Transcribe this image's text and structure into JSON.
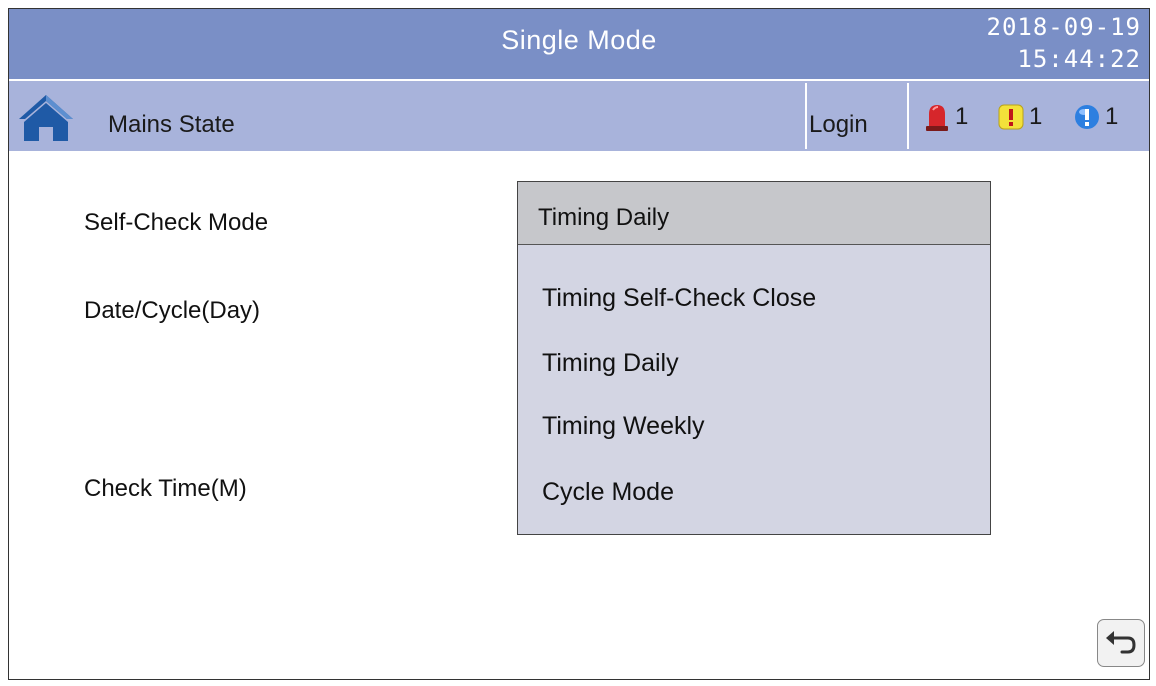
{
  "header": {
    "title": "Single Mode",
    "date": "2018-09-19",
    "time": "15:44:22"
  },
  "status_bar": {
    "home_icon": "home-icon",
    "state_label": "Mains State",
    "login_label": "Login",
    "alarms": [
      {
        "icon": "red-alarm-light-icon",
        "count": "1"
      },
      {
        "icon": "yellow-warning-icon",
        "count": "1"
      },
      {
        "icon": "blue-info-icon",
        "count": "1"
      }
    ]
  },
  "form": {
    "self_check_mode_label": "Self-Check Mode",
    "date_cycle_label": "Date/Cycle(Day)",
    "check_time_label": "Check Time(M)"
  },
  "dropdown": {
    "selected": "Timing Daily",
    "options": [
      "Timing Self-Check Close",
      "Timing Daily",
      "Timing Weekly",
      "Cycle Mode"
    ]
  },
  "back_icon": "back-arrow-icon",
  "colors": {
    "title_bar": "#7a8fc6",
    "status_bar": "#a8b3db",
    "dropdown_bg": "#d3d5e3",
    "dropdown_selected_bg": "#c6c7cb"
  }
}
